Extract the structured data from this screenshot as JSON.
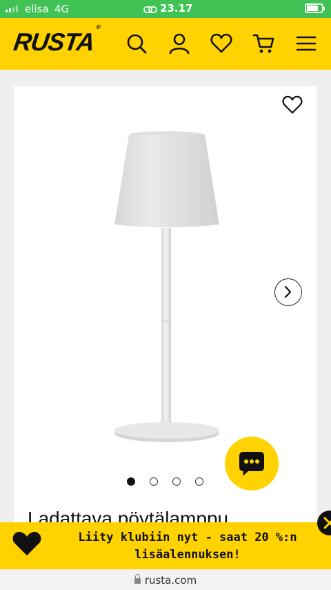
{
  "status_bar": {
    "carrier": "elisa",
    "network": "4G",
    "time": "23.17",
    "signal_bars_filled": 2
  },
  "header": {
    "logo": "RUSTA",
    "logo_mark": "®",
    "icons": [
      "search-icon",
      "account-icon",
      "heart-icon",
      "cart-icon",
      "menu-icon"
    ]
  },
  "product": {
    "title": "Ladattava pöytälamppu",
    "image_count": 4,
    "active_image": 1,
    "icons": [
      "wishlist-heart-icon",
      "chevron-right-icon"
    ]
  },
  "chat": {
    "icon": "chat-bubble-icon"
  },
  "promo": {
    "line1": "Liity klubiin nyt - saat 20 %:n",
    "line2": "lisäalennuksen!",
    "icons": [
      "heart-logo-icon",
      "close-icon"
    ]
  },
  "browser": {
    "url": "rusta.com"
  },
  "colors": {
    "brand_yellow": "#ffd200",
    "status_green": "#41c254",
    "text": "#111111"
  }
}
